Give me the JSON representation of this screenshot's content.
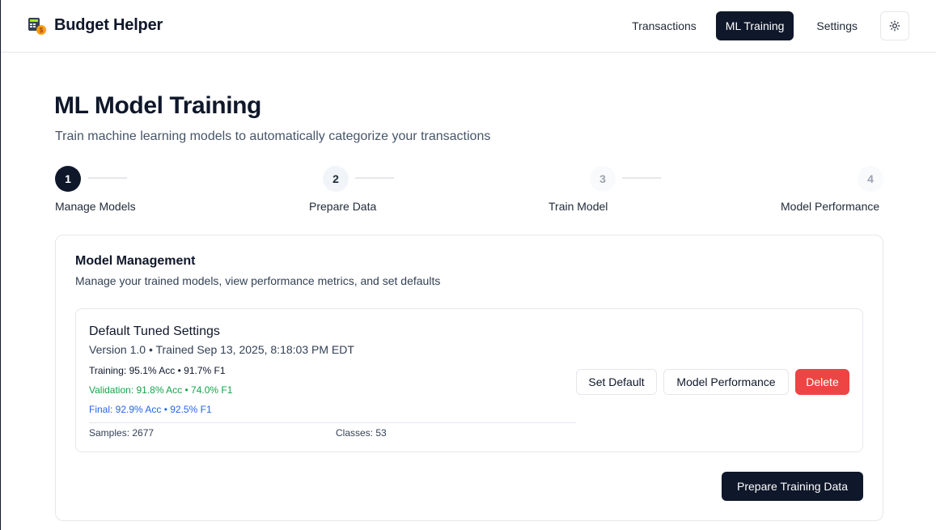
{
  "header": {
    "brand": "Budget Helper",
    "nav": [
      "Transactions",
      "ML Training",
      "Settings"
    ],
    "active_nav": "ML Training",
    "theme_icon": "sun-icon"
  },
  "page": {
    "title": "ML Model Training",
    "subtitle": "Train machine learning models to automatically categorize your transactions"
  },
  "stepper": {
    "steps": [
      {
        "number": "1",
        "label": "Manage Models",
        "state": "active"
      },
      {
        "number": "2",
        "label": "Prepare Data",
        "state": "visited"
      },
      {
        "number": "3",
        "label": "Train Model",
        "state": "disabled"
      },
      {
        "number": "4",
        "label": "Model Performance",
        "state": "disabled"
      }
    ]
  },
  "card": {
    "title": "Model Management",
    "description": "Manage your trained models, view performance metrics, and set defaults",
    "model": {
      "name": "Default Tuned Settings",
      "meta": "Version 1.0 • Trained Sep 13, 2025, 8:18:03 PM EDT",
      "training": "Training: 95.1% Acc • 91.7% F1",
      "validation": "Validation: 91.8% Acc • 74.0% F1",
      "final": "Final: 92.9% Acc • 92.5% F1",
      "samples": "Samples: 2677",
      "classes": "Classes: 53",
      "actions": {
        "set_default": "Set Default",
        "performance": "Model Performance",
        "delete": "Delete"
      }
    },
    "primary_action": "Prepare Training Data"
  },
  "colors": {
    "primary": "#0f172a",
    "validation": "#16a34a",
    "final": "#2563eb",
    "danger": "#ef4444"
  }
}
